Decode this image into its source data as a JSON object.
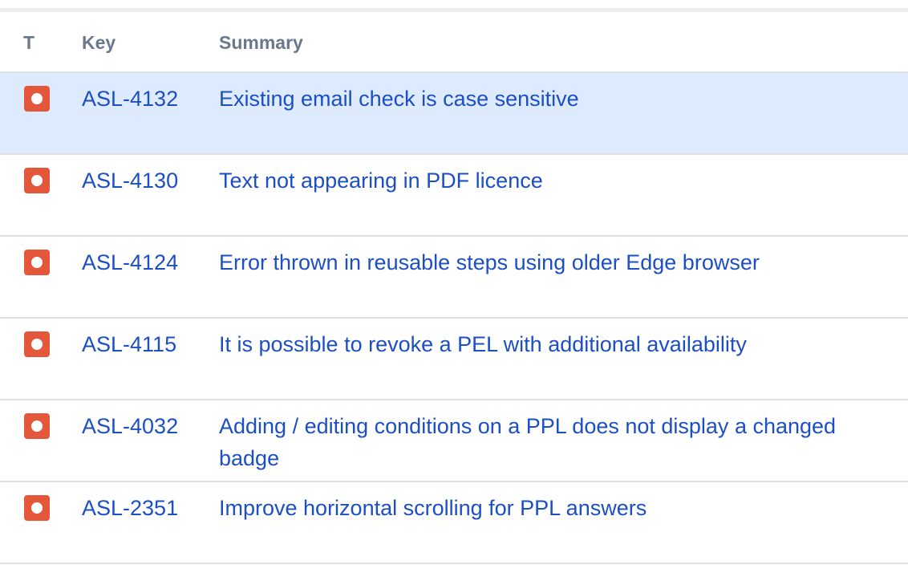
{
  "table": {
    "headers": {
      "type": "T",
      "key": "Key",
      "summary": "Summary"
    },
    "rows": [
      {
        "type_icon": "bug-icon",
        "key": "ASL-4132",
        "summary": "Existing email check is case sensitive",
        "selected": true
      },
      {
        "type_icon": "bug-icon",
        "key": "ASL-4130",
        "summary": "Text not appearing in PDF licence",
        "selected": false
      },
      {
        "type_icon": "bug-icon",
        "key": "ASL-4124",
        "summary": "Error thrown in reusable steps using older Edge browser",
        "selected": false
      },
      {
        "type_icon": "bug-icon",
        "key": "ASL-4115",
        "summary": "It is possible to revoke a PEL with additional availability",
        "selected": false
      },
      {
        "type_icon": "bug-icon",
        "key": "ASL-4032",
        "summary": "Adding / editing conditions on a PPL does not display a changed badge",
        "selected": false
      },
      {
        "type_icon": "bug-icon",
        "key": "ASL-2351",
        "summary": "Improve horizontal scrolling for PPL answers",
        "selected": false
      }
    ]
  },
  "colors": {
    "link": "#1c4fc4",
    "bug_icon": "#e5573b",
    "selected_row": "#deebff",
    "header_text": "#6b778c"
  }
}
